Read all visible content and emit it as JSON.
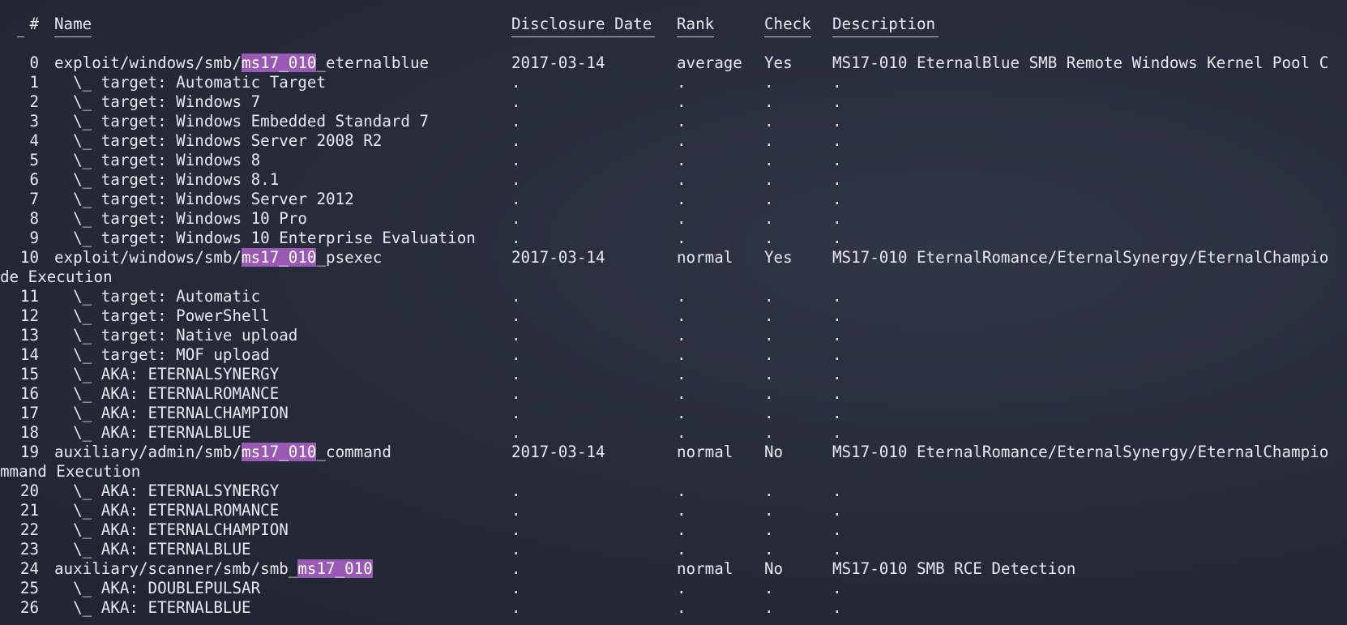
{
  "columns": {
    "index": "#",
    "name": "Name",
    "date": "Disclosure Date",
    "rank": "Rank",
    "check": "Check",
    "description": "Description"
  },
  "search_term": "ms17_010",
  "rows": [
    {
      "i": "0",
      "pre": "exploit/windows/smb/",
      "hl": "ms17_010",
      "post": "_eternalblue",
      "date": "2017-03-14",
      "rank": "average",
      "check": "Yes",
      "desc": "MS17-010 EternalBlue SMB Remote Windows Kernel Pool C"
    },
    {
      "i": "1",
      "pre": "  \\_ target: Automatic Target",
      "hl": "",
      "post": "",
      "date": ".",
      "rank": ".",
      "check": ".",
      "desc": "."
    },
    {
      "i": "2",
      "pre": "  \\_ target: Windows 7",
      "hl": "",
      "post": "",
      "date": ".",
      "rank": ".",
      "check": ".",
      "desc": "."
    },
    {
      "i": "3",
      "pre": "  \\_ target: Windows Embedded Standard 7",
      "hl": "",
      "post": "",
      "date": ".",
      "rank": ".",
      "check": ".",
      "desc": "."
    },
    {
      "i": "4",
      "pre": "  \\_ target: Windows Server 2008 R2",
      "hl": "",
      "post": "",
      "date": ".",
      "rank": ".",
      "check": ".",
      "desc": "."
    },
    {
      "i": "5",
      "pre": "  \\_ target: Windows 8",
      "hl": "",
      "post": "",
      "date": ".",
      "rank": ".",
      "check": ".",
      "desc": "."
    },
    {
      "i": "6",
      "pre": "  \\_ target: Windows 8.1",
      "hl": "",
      "post": "",
      "date": ".",
      "rank": ".",
      "check": ".",
      "desc": "."
    },
    {
      "i": "7",
      "pre": "  \\_ target: Windows Server 2012",
      "hl": "",
      "post": "",
      "date": ".",
      "rank": ".",
      "check": ".",
      "desc": "."
    },
    {
      "i": "8",
      "pre": "  \\_ target: Windows 10 Pro",
      "hl": "",
      "post": "",
      "date": ".",
      "rank": ".",
      "check": ".",
      "desc": "."
    },
    {
      "i": "9",
      "pre": "  \\_ target: Windows 10 Enterprise Evaluation",
      "hl": "",
      "post": "",
      "date": ".",
      "rank": ".",
      "check": ".",
      "desc": "."
    },
    {
      "i": "10",
      "pre": "exploit/windows/smb/",
      "hl": "ms17_010",
      "post": "_psexec",
      "date": "2017-03-14",
      "rank": "normal",
      "check": "Yes",
      "desc": "MS17-010 EternalRomance/EternalSynergy/EternalChampio"
    },
    {
      "wrap": "de Execution"
    },
    {
      "i": "11",
      "pre": "  \\_ target: Automatic",
      "hl": "",
      "post": "",
      "date": ".",
      "rank": ".",
      "check": ".",
      "desc": "."
    },
    {
      "i": "12",
      "pre": "  \\_ target: PowerShell",
      "hl": "",
      "post": "",
      "date": ".",
      "rank": ".",
      "check": ".",
      "desc": "."
    },
    {
      "i": "13",
      "pre": "  \\_ target: Native upload",
      "hl": "",
      "post": "",
      "date": ".",
      "rank": ".",
      "check": ".",
      "desc": "."
    },
    {
      "i": "14",
      "pre": "  \\_ target: MOF upload",
      "hl": "",
      "post": "",
      "date": ".",
      "rank": ".",
      "check": ".",
      "desc": "."
    },
    {
      "i": "15",
      "pre": "  \\_ AKA: ETERNALSYNERGY",
      "hl": "",
      "post": "",
      "date": ".",
      "rank": ".",
      "check": ".",
      "desc": "."
    },
    {
      "i": "16",
      "pre": "  \\_ AKA: ETERNALROMANCE",
      "hl": "",
      "post": "",
      "date": ".",
      "rank": ".",
      "check": ".",
      "desc": "."
    },
    {
      "i": "17",
      "pre": "  \\_ AKA: ETERNALCHAMPION",
      "hl": "",
      "post": "",
      "date": ".",
      "rank": ".",
      "check": ".",
      "desc": "."
    },
    {
      "i": "18",
      "pre": "  \\_ AKA: ETERNALBLUE",
      "hl": "",
      "post": "",
      "date": ".",
      "rank": ".",
      "check": ".",
      "desc": "."
    },
    {
      "i": "19",
      "pre": "auxiliary/admin/smb/",
      "hl": "ms17_010",
      "post": "_command",
      "date": "2017-03-14",
      "rank": "normal",
      "check": "No",
      "desc": "MS17-010 EternalRomance/EternalSynergy/EternalChampio"
    },
    {
      "wrap": "mmand Execution"
    },
    {
      "i": "20",
      "pre": "  \\_ AKA: ETERNALSYNERGY",
      "hl": "",
      "post": "",
      "date": ".",
      "rank": ".",
      "check": ".",
      "desc": "."
    },
    {
      "i": "21",
      "pre": "  \\_ AKA: ETERNALROMANCE",
      "hl": "",
      "post": "",
      "date": ".",
      "rank": ".",
      "check": ".",
      "desc": "."
    },
    {
      "i": "22",
      "pre": "  \\_ AKA: ETERNALCHAMPION",
      "hl": "",
      "post": "",
      "date": ".",
      "rank": ".",
      "check": ".",
      "desc": "."
    },
    {
      "i": "23",
      "pre": "  \\_ AKA: ETERNALBLUE",
      "hl": "",
      "post": "",
      "date": ".",
      "rank": ".",
      "check": ".",
      "desc": "."
    },
    {
      "i": "24",
      "pre": "auxiliary/scanner/smb/smb_",
      "hl": "ms17_010",
      "post": "",
      "date": ".",
      "rank": "normal",
      "check": "No",
      "desc": "MS17-010 SMB RCE Detection"
    },
    {
      "i": "25",
      "pre": "  \\_ AKA: DOUBLEPULSAR",
      "hl": "",
      "post": "",
      "date": ".",
      "rank": ".",
      "check": ".",
      "desc": "."
    },
    {
      "i": "26",
      "pre": "  \\_ AKA: ETERNALBLUE",
      "hl": "",
      "post": "",
      "date": ".",
      "rank": ".",
      "check": ".",
      "desc": "."
    }
  ],
  "colors": {
    "background": "#262c3a",
    "text": "#e8e8ee",
    "highlight": "#9b59b6"
  }
}
